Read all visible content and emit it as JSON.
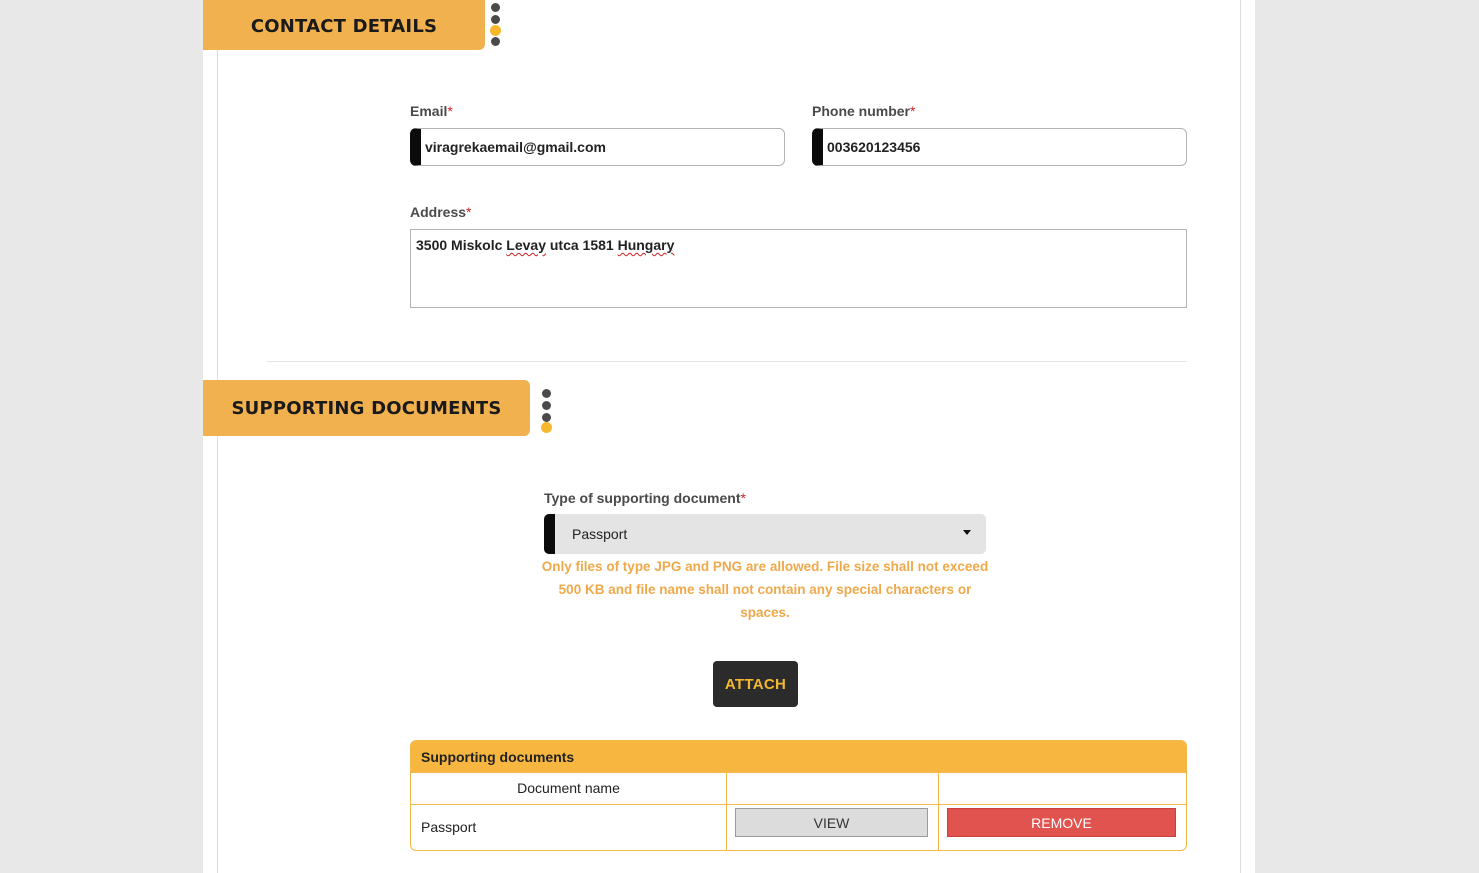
{
  "contact_section": {
    "title": "CONTACT DETAILS",
    "email": {
      "label": "Email",
      "required_mark": "*",
      "value": "viragrekaemail@gmail.com"
    },
    "phone": {
      "label": "Phone number",
      "required_mark": "*",
      "value": "003620123456"
    },
    "address": {
      "label": "Address",
      "required_mark": "*",
      "value_parts": [
        "3500 Miskolc ",
        "Levay",
        " utca 1581 ",
        "Hungary"
      ]
    }
  },
  "documents_section": {
    "title": "SUPPORTING DOCUMENTS",
    "doc_type": {
      "label": "Type of supporting document",
      "required_mark": "*",
      "selected": "Passport"
    },
    "note": "Only files of type JPG and PNG are allowed. File size shall not exceed 500 KB and file name shall not contain any special characters or spaces.",
    "attach_label": "ATTACH",
    "table": {
      "caption": "Supporting documents",
      "columns": [
        "Document name",
        "",
        ""
      ],
      "rows": [
        {
          "document_name": "Passport",
          "view_label": "VIEW",
          "remove_label": "REMOVE"
        }
      ]
    }
  },
  "colors": {
    "banner": "#f2b14f",
    "accent_dot": "#f7b82e",
    "note_text": "#f0a94a",
    "remove_button": "#e0534f",
    "attach_button": "#2b2b2b"
  }
}
